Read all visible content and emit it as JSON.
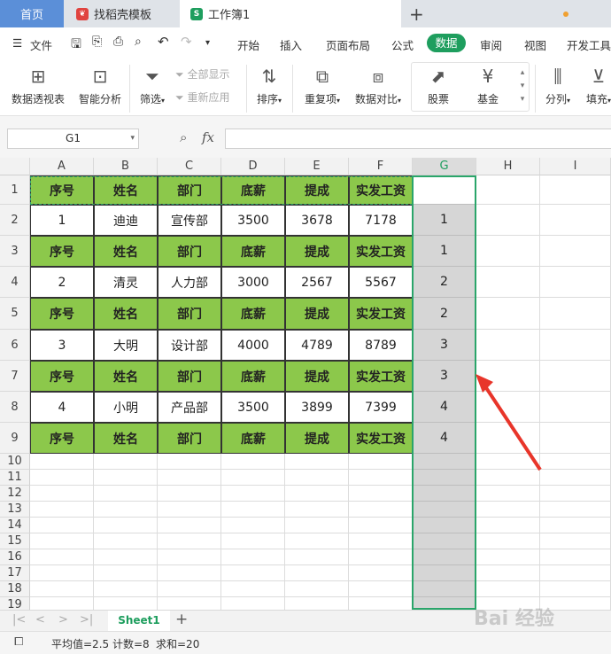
{
  "tabs": {
    "home": "首页",
    "template": "找稻壳模板",
    "workbook": "工作簿1"
  },
  "menu": {
    "file": "文件",
    "items": [
      "开始",
      "插入",
      "页面布局",
      "公式",
      "数据",
      "审阅",
      "视图",
      "开发工具"
    ]
  },
  "ribbon": {
    "pivot": "数据透视表",
    "smart": "智能分析",
    "filter": "筛选",
    "show_all": "全部显示",
    "reapply": "重新应用",
    "sort": "排序",
    "dup": "重复项",
    "compare": "数据对比",
    "stock": "股票",
    "fund": "基金",
    "split": "分列",
    "fill": "填充"
  },
  "formula_bar": {
    "name_box": "G1",
    "fx": "fx"
  },
  "columns": [
    "A",
    "B",
    "C",
    "D",
    "E",
    "F",
    "G",
    "H",
    "I"
  ],
  "rows": [
    "1",
    "2",
    "3",
    "4",
    "5",
    "6",
    "7",
    "8",
    "9",
    "10",
    "11",
    "12",
    "13",
    "14",
    "15",
    "16",
    "17",
    "18",
    "19"
  ],
  "table_header": [
    "序号",
    "姓名",
    "部门",
    "底薪",
    "提成",
    "实发工资"
  ],
  "table_rows": [
    [
      "1",
      "迪迪",
      "宣传部",
      "3500",
      "3678",
      "7178"
    ],
    [
      "2",
      "清灵",
      "人力部",
      "3000",
      "2567",
      "5567"
    ],
    [
      "3",
      "大明",
      "设计部",
      "4000",
      "4789",
      "8789"
    ],
    [
      "4",
      "小明",
      "产品部",
      "3500",
      "3899",
      "7399"
    ]
  ],
  "g_values": [
    "",
    "1",
    "1",
    "2",
    "2",
    "3",
    "3",
    "4",
    "4"
  ],
  "sheet": {
    "name": "Sheet1"
  },
  "status": {
    "avg": "平均值=2.5",
    "count": "计数=8",
    "sum": "求和=20"
  },
  "watermark": "Bai 经验",
  "colors": {
    "header_fill": "#8cc84b",
    "accent": "#1e9e5e",
    "selection": "#2aa56a",
    "arrow": "#e8352a"
  }
}
